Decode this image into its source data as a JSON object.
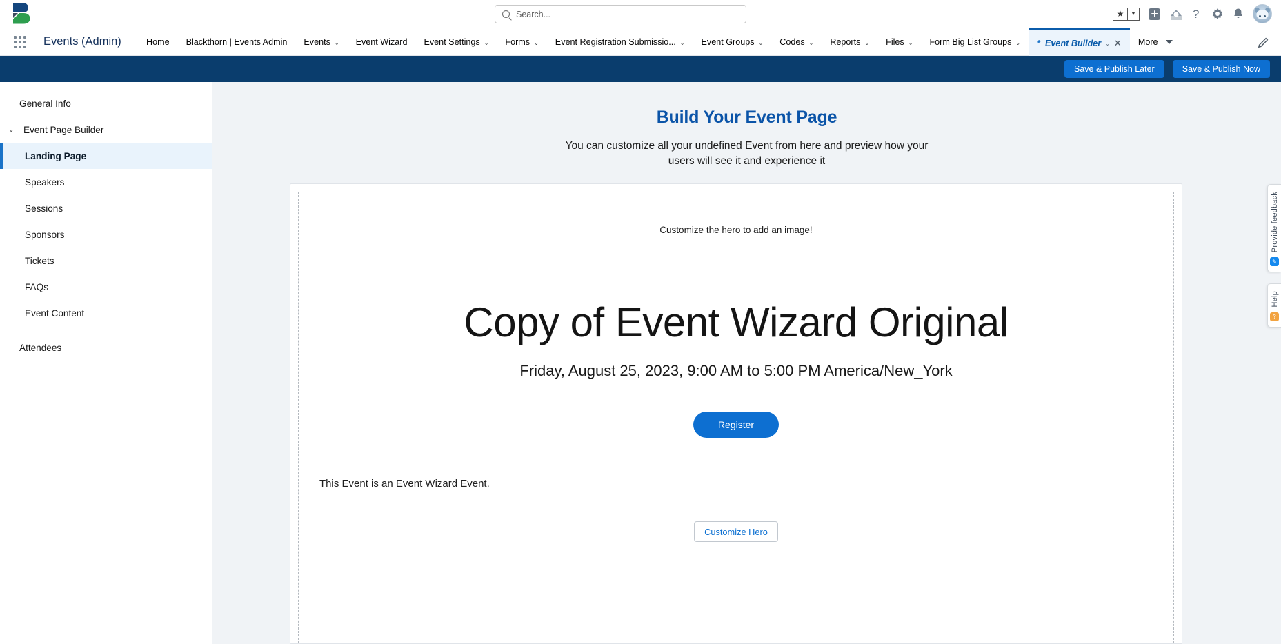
{
  "header": {
    "logo_name": "blackthorn-logo",
    "search": {
      "placeholder": "Search...",
      "value": "",
      "icon": "search-icon"
    },
    "icons": [
      {
        "name": "favorites-star-icon",
        "glyph": "★"
      },
      {
        "name": "favorites-dropdown-icon",
        "glyph": "▾"
      },
      {
        "name": "add-icon",
        "glyph": "+"
      },
      {
        "name": "cloud-setup-icon",
        "glyph": "☁"
      },
      {
        "name": "help-icon",
        "glyph": "?"
      },
      {
        "name": "setup-gear-icon",
        "glyph": "✺"
      },
      {
        "name": "notifications-bell-icon",
        "glyph": "🔔"
      },
      {
        "name": "user-avatar",
        "glyph": ""
      }
    ]
  },
  "app_nav": {
    "waffle_label": "app-launcher",
    "app_name": "Events (Admin)",
    "items": [
      {
        "label": "Home",
        "has_caret": false,
        "active": false
      },
      {
        "label": "Blackthorn | Events Admin",
        "has_caret": false,
        "active": false
      },
      {
        "label": "Events",
        "has_caret": true,
        "active": false
      },
      {
        "label": "Event Wizard",
        "has_caret": false,
        "active": false
      },
      {
        "label": "Event Settings",
        "has_caret": true,
        "active": false
      },
      {
        "label": "Forms",
        "has_caret": true,
        "active": false
      },
      {
        "label": "Event Registration Submissio...",
        "has_caret": true,
        "active": false
      },
      {
        "label": "Event Groups",
        "has_caret": true,
        "active": false
      },
      {
        "label": "Codes",
        "has_caret": true,
        "active": false
      },
      {
        "label": "Reports",
        "has_caret": true,
        "active": false
      },
      {
        "label": "Files",
        "has_caret": true,
        "active": false
      },
      {
        "label": "Form Big List Groups",
        "has_caret": true,
        "active": false
      }
    ],
    "active_tab": {
      "unsaved_marker": "*",
      "label": "Event Builder",
      "caret": "⌄",
      "close": "✕"
    },
    "more": {
      "label": "More"
    },
    "edit_icon": "pencil-icon"
  },
  "action_bar": {
    "save_publish_later": "Save & Publish Later",
    "save_publish_now": "Save & Publish Now",
    "background_color": "#0a3d6d",
    "button_color": "#0d6fd1"
  },
  "sidebar": {
    "items": [
      {
        "label": "General Info",
        "type": "top",
        "selected": false
      },
      {
        "label": "Event Page Builder",
        "type": "section",
        "expanded": true,
        "chevron": "⌄"
      },
      {
        "label": "Landing Page",
        "type": "child",
        "selected": true
      },
      {
        "label": "Speakers",
        "type": "child",
        "selected": false
      },
      {
        "label": "Sessions",
        "type": "child",
        "selected": false
      },
      {
        "label": "Sponsors",
        "type": "child",
        "selected": false
      },
      {
        "label": "Tickets",
        "type": "child",
        "selected": false
      },
      {
        "label": "FAQs",
        "type": "child",
        "selected": false
      },
      {
        "label": "Event Content",
        "type": "child",
        "selected": false
      },
      {
        "label": "Attendees",
        "type": "top",
        "selected": false
      }
    ]
  },
  "main": {
    "title": "Build Your Event Page",
    "title_color": "#0b54a8",
    "subtitle": "You can customize all your undefined Event from here and preview how your users will see it and experience it",
    "preview": {
      "hero_hint": "Customize the hero to add an image!",
      "event_title": "Copy of Event Wizard Original",
      "event_date": "Friday, August 25, 2023, 9:00 AM to 5:00 PM America/New_York",
      "register_label": "Register",
      "register_color": "#0d6fd1",
      "description": "This Event is an Event Wizard Event.",
      "customize_hero_label": "Customize Hero"
    }
  },
  "rail": {
    "feedback_label": "Provide feedback",
    "help_label": "Help"
  }
}
